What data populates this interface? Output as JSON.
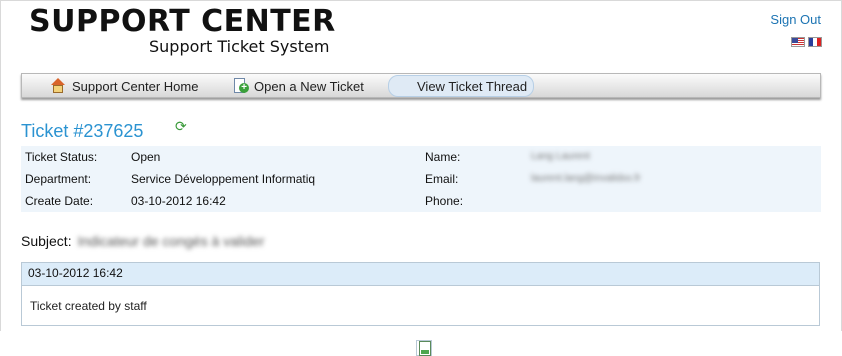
{
  "header": {
    "logo_title": "SUPPORT CENTER",
    "logo_subtitle": "Support Ticket System",
    "sign_out": "Sign Out",
    "flags": [
      "us-flag",
      "fr-flag"
    ]
  },
  "nav": {
    "items": [
      {
        "label": "Support Center Home",
        "icon": "home-icon"
      },
      {
        "label": "Open a New Ticket",
        "icon": "new-ticket-icon"
      },
      {
        "label": "View Ticket Thread",
        "icon": "ticket-thread-icon",
        "active": true
      }
    ]
  },
  "ticket": {
    "title": "Ticket #237625",
    "status_label": "Ticket Status:",
    "status_value": "Open",
    "department_label": "Department:",
    "department_value": "Service Développement Informatiq",
    "create_date_label": "Create Date:",
    "create_date_value": "03-10-2012 16:42",
    "name_label": "Name:",
    "name_value": "Lang Laurent",
    "email_label": "Email:",
    "email_value": "laurent.lang@invalidxx.fr",
    "phone_label": "Phone:",
    "phone_value": ""
  },
  "subject": {
    "label": "Subject:",
    "value": "Indicateur de congés à valider"
  },
  "thread": {
    "date": "03-10-2012 16:42",
    "message": "Ticket created by staff"
  },
  "colors": {
    "accent": "#2b93d1",
    "info_bg": "#eef5fb",
    "thread_header_bg": "#dcecf9"
  }
}
